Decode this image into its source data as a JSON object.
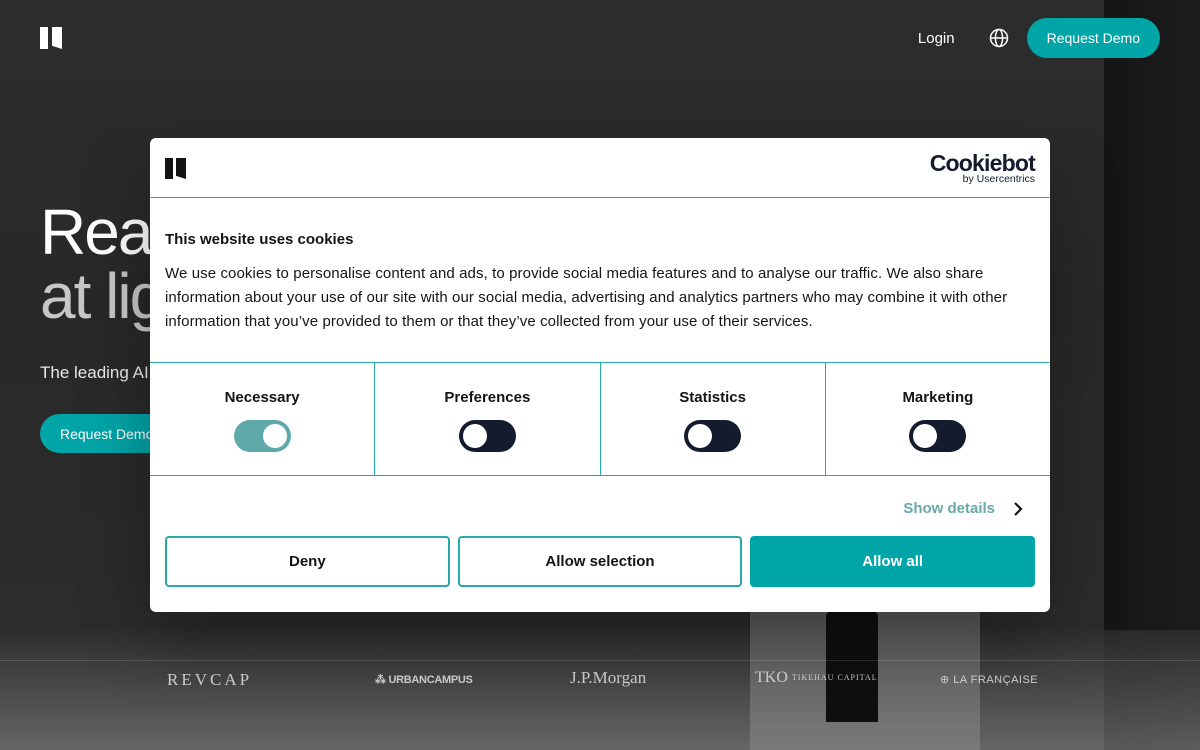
{
  "header": {
    "login_label": "Login",
    "demo_label": "Request Demo",
    "globe_icon": "globe-icon",
    "logo_icon": "brand-logo-icon"
  },
  "hero": {
    "title_line1": "Real",
    "title_line2": "at lig",
    "subtitle": "The leading AI",
    "cta_label": "Request Demo"
  },
  "partners": [
    "REVCAP",
    "URBANCAMPUS",
    "J.P.Morgan",
    "TKO",
    "LA FRANÇAISE"
  ],
  "partner_subtext": "TIKEHAU CAPITAL",
  "cookie": {
    "brand": "Cookiebot",
    "brand_sub": "by Usercentrics",
    "title": "This website uses cookies",
    "text": "We use cookies to personalise content and ads, to provide social media features and to analyse our traffic. We also share information about your use of our site with our social media, advertising and analytics partners who may combine it with other information that you’ve provided to them or that they’ve collected from your use of their services.",
    "toggles": [
      {
        "label": "Necessary",
        "on": true
      },
      {
        "label": "Preferences",
        "on": false
      },
      {
        "label": "Statistics",
        "on": false
      },
      {
        "label": "Marketing",
        "on": false
      }
    ],
    "show_details": "Show details",
    "deny": "Deny",
    "allow_selection": "Allow selection",
    "allow_all": "Allow all"
  },
  "colors": {
    "accent": "#00a5a8",
    "toggle_off": "#141b2d",
    "toggle_on": "#5fa9aa"
  }
}
